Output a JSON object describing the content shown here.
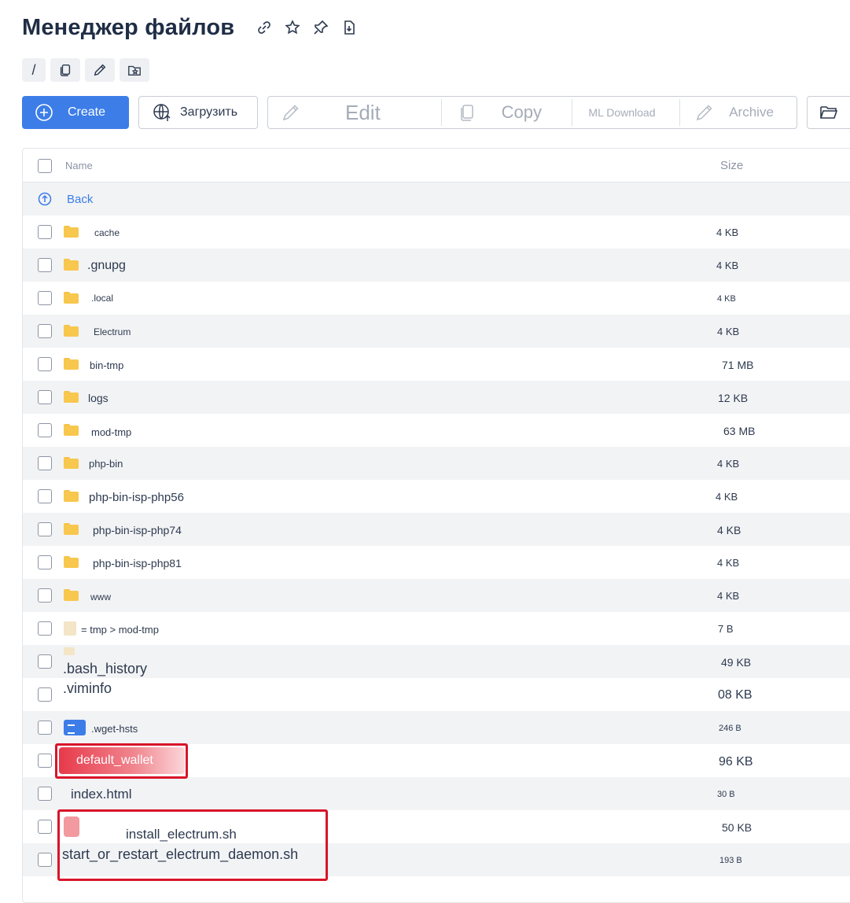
{
  "header": {
    "title": "Менеджер файлов",
    "icons": [
      "link-icon",
      "star-icon",
      "pin-icon",
      "download-file-icon"
    ]
  },
  "path": {
    "root": "/",
    "chip_icons": [
      "copy-icon",
      "pencil-icon",
      "favorite-folder-icon"
    ]
  },
  "toolbar": {
    "create_label": "Create",
    "upload_label": "Загрузить",
    "edit_label": "Edit",
    "copy_label": "Copy",
    "ml_download_label": "ML Download",
    "archive_label": "Archive"
  },
  "table": {
    "col_name": "Name",
    "col_size": "Size",
    "back_label": "Back",
    "rows": [
      {
        "name": "cache",
        "size": "4 KB",
        "type": "folder"
      },
      {
        "name": ".gnupg",
        "size": "4 KB",
        "type": "folder"
      },
      {
        "name": ".local",
        "size": "4 KB",
        "type": "folder"
      },
      {
        "name": "Electrum",
        "size": "4 KB",
        "type": "folder"
      },
      {
        "name": "bin-tmp",
        "size": "71 MB",
        "type": "folder"
      },
      {
        "name": "logs",
        "size": "12 KB",
        "type": "folder"
      },
      {
        "name": "mod-tmp",
        "size": "63 MB",
        "type": "folder"
      },
      {
        "name": "php-bin",
        "size": "4 KB",
        "type": "folder"
      },
      {
        "name": "php-bin-isp-php56",
        "size": "4 KB",
        "type": "folder"
      },
      {
        "name": "php-bin-isp-php74",
        "size": "4 KB",
        "type": "folder"
      },
      {
        "name": "php-bin-isp-php81",
        "size": "4 KB",
        "type": "folder"
      },
      {
        "name": "www",
        "size": "4 KB",
        "type": "folder"
      },
      {
        "name": "= tmp > mod-tmp",
        "size": "7 B",
        "type": "link"
      },
      {
        "name": ".bash_history",
        "size": "49 KB",
        "type": "file"
      },
      {
        "name": ".viminfo",
        "size": "08 KB",
        "type": "file"
      },
      {
        "name": ".wget-hsts",
        "size": "246 B",
        "type": "doc"
      },
      {
        "name": "default_wallet",
        "size": "96 KB",
        "type": "file"
      },
      {
        "name": "index.html",
        "size": "30 B",
        "type": "file"
      },
      {
        "name": "install_electrum.sh",
        "size": "50 KB",
        "type": "file"
      },
      {
        "name": "start_or_restart_electrum_daemon.sh",
        "size": "193 B",
        "type": "file"
      }
    ]
  },
  "colors": {
    "accent": "#3c7de8",
    "highlight": "#d9142a",
    "folder": "#f8c74e"
  }
}
